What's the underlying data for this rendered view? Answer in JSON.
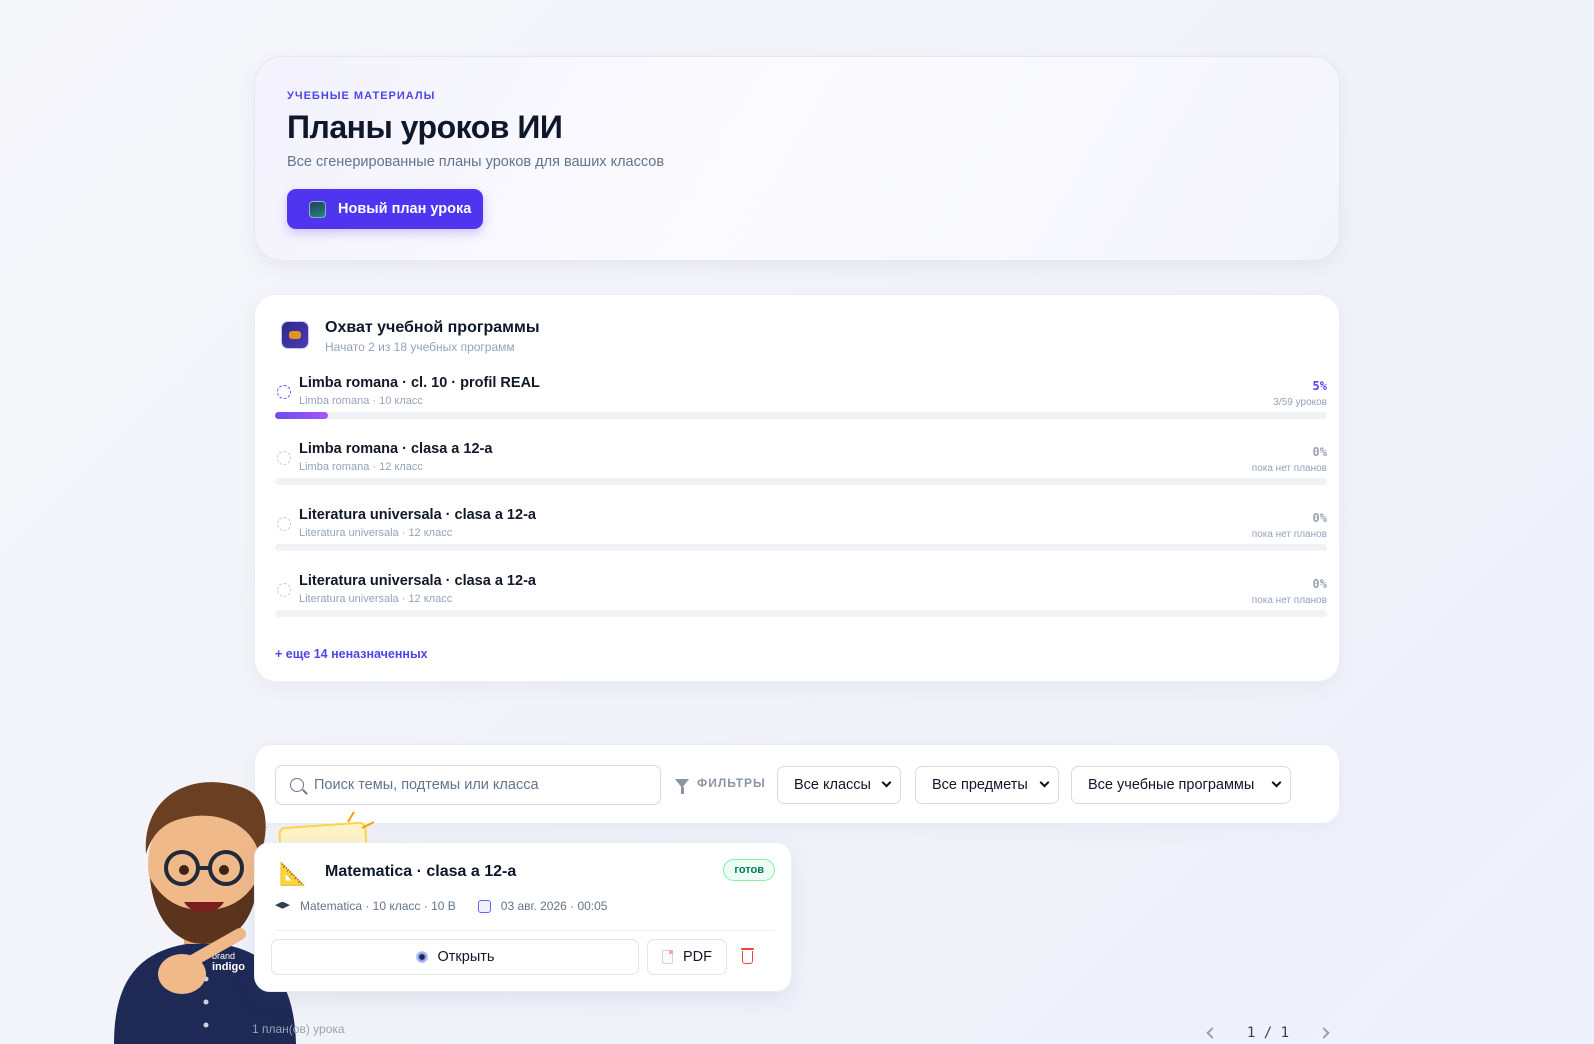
{
  "hero": {
    "eyebrow": "УЧЕБНЫЕ МАТЕРИАЛЫ",
    "title": "Планы уроков ИИ",
    "subtitle": "Все сгенерированные планы уроков для ваших классов",
    "new_button": "Новый план урока"
  },
  "coverage": {
    "title": "Охват учебной программы",
    "subtitle": "Начато 2 из 18 учебных программ",
    "rows": [
      {
        "name": "Limba romana · cl. 10 · profil REAL",
        "meta": "Limba romana · 10 класс",
        "percent": "5%",
        "count": "3/59 уроков",
        "progress": 0.05,
        "active": true
      },
      {
        "name": "Limba romana · clasa a 12-a",
        "meta": "Limba romana · 12 класс",
        "percent": "0%",
        "count": "пока нет планов",
        "progress": 0,
        "active": false
      },
      {
        "name": "Literatura universala · clasa a 12-a",
        "meta": "Literatura universala · 12 класс",
        "percent": "0%",
        "count": "пока нет планов",
        "progress": 0,
        "active": false
      },
      {
        "name": "Literatura universala · clasa a 12-a",
        "meta": "Literatura universala · 12 класс",
        "percent": "0%",
        "count": "пока нет планов",
        "progress": 0,
        "active": false
      }
    ],
    "more_link": "+ еще 14 неназначенных"
  },
  "filters": {
    "search_placeholder": "Поиск темы, подтемы или класса",
    "label": "ФИЛЬТРЫ",
    "class_select": "Все классы",
    "subject_select": "Все предметы",
    "program_select": "Все учебные программы"
  },
  "lesson": {
    "title": "Matematica · clasa a 12-a",
    "status": "готов",
    "meta": "Matematica · 10 класс · 10 В",
    "date": "03 авг. 2026 · 00:05",
    "open_button": "Открыть",
    "pdf_button": "PDF"
  },
  "footer": {
    "count": "1 план(ов) урока",
    "pages": "1 / 1"
  },
  "mascot": {
    "shirt_text_1": "brand",
    "shirt_text_2": "indigo"
  },
  "colors": {
    "accent": "#4f35f0",
    "status_green": "#047857",
    "danger": "#ef4444"
  },
  "icons": {
    "new_plan": "book-sparkle-icon",
    "coverage": "curriculum-icon",
    "search": "search-icon",
    "filter": "funnel-icon",
    "lesson": "triangle-ruler-icon",
    "open": "eye-icon",
    "pdf": "document-icon",
    "delete": "trash-icon"
  }
}
